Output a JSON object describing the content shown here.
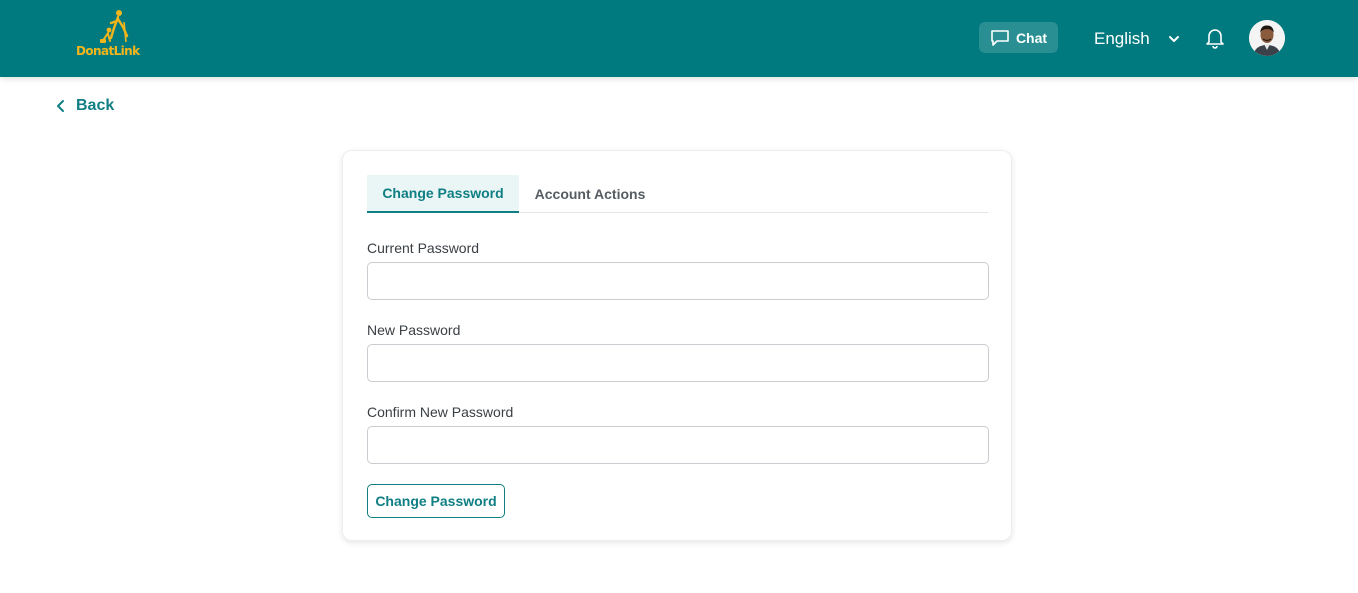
{
  "header": {
    "logo_text": "DonatLink",
    "chat_label": "Chat",
    "language_label": "English",
    "icons": {
      "chat": "chat-bubble-icon",
      "language_dropdown": "chevron-down-icon",
      "notifications": "bell-icon",
      "avatar": "user-avatar"
    }
  },
  "nav": {
    "back_label": "Back",
    "back_icon": "chevron-left-icon"
  },
  "tabs": [
    {
      "label": "Change Password",
      "active": true
    },
    {
      "label": "Account Actions",
      "active": false
    }
  ],
  "form": {
    "fields": [
      {
        "label": "Current Password",
        "value": ""
      },
      {
        "label": "New Password",
        "value": ""
      },
      {
        "label": "Confirm New Password",
        "value": ""
      }
    ],
    "submit_label": "Change Password"
  },
  "colors": {
    "header_bg": "#007a7e",
    "accent": "#0f7f83",
    "logo": "#f2b51b"
  }
}
